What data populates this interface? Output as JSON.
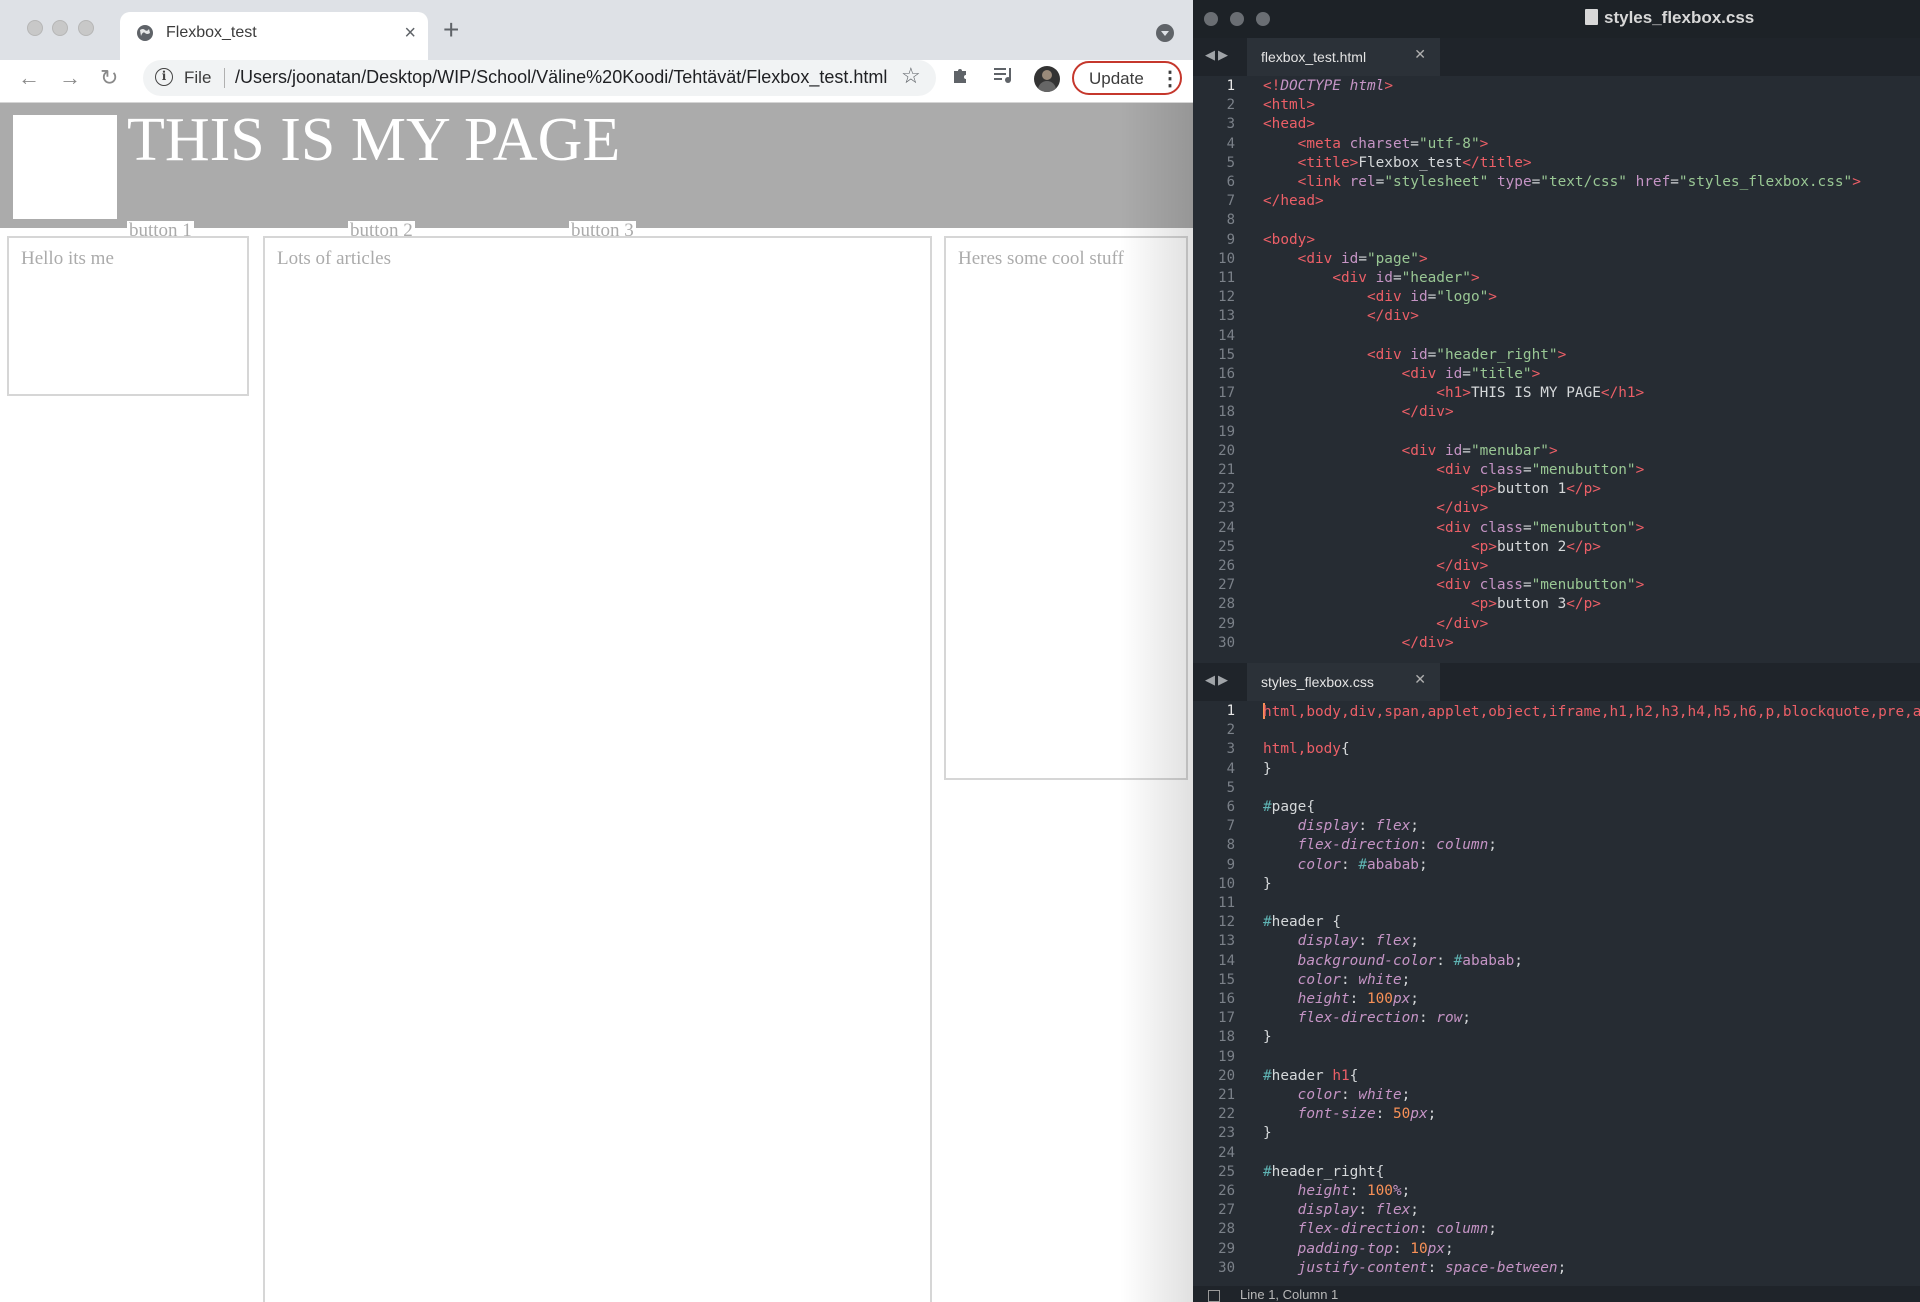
{
  "browser": {
    "tab_title": "Flexbox_test",
    "tab_close": "×",
    "new_tab": "+",
    "nav": {
      "back": "←",
      "forward": "→",
      "reload": "↻"
    },
    "omnibox": {
      "scheme_label": "File",
      "url": "/Users/joonatan/Desktop/WIP/School/Väline%20Koodi/Tehtävät/Flexbox_test.html",
      "star": "☆"
    },
    "update_label": "Update",
    "menu_dots": "⋮",
    "accent": "#c5372c"
  },
  "webpage": {
    "title": "THIS IS MY PAGE",
    "buttons": [
      "button 1",
      "button 2",
      "button 3"
    ],
    "columns": [
      "Hello its me",
      "Lots of articles",
      "Heres some cool stuff"
    ],
    "header_color": "#ababab",
    "text_color": "#ababab"
  },
  "editor": {
    "window_title": "styles_flexbox.css",
    "top_pane": {
      "tab": "flexbox_test.html",
      "active_line": 1,
      "lines": [
        [
          [
            "k",
            "<!"
          ],
          [
            "i",
            "DOCTYPE"
          ],
          [
            "w",
            " "
          ],
          [
            "i",
            "html"
          ],
          [
            "k",
            ">"
          ]
        ],
        [
          [
            "k",
            "<html>"
          ]
        ],
        [
          [
            "k",
            "<head>"
          ]
        ],
        [
          [
            "w",
            "    "
          ],
          [
            "k",
            "<meta "
          ],
          [
            "a",
            "charset"
          ],
          [
            "w",
            "="
          ],
          [
            "s",
            "\"utf-8\""
          ],
          [
            "k",
            ">"
          ]
        ],
        [
          [
            "w",
            "    "
          ],
          [
            "k",
            "<title>"
          ],
          [
            "w",
            "Flexbox_test"
          ],
          [
            "k",
            "</title>"
          ]
        ],
        [
          [
            "w",
            "    "
          ],
          [
            "k",
            "<link "
          ],
          [
            "a",
            "rel"
          ],
          [
            "w",
            "="
          ],
          [
            "s",
            "\"stylesheet\""
          ],
          [
            "w",
            " "
          ],
          [
            "a",
            "type"
          ],
          [
            "w",
            "="
          ],
          [
            "s",
            "\"text/css\""
          ],
          [
            "w",
            " "
          ],
          [
            "a",
            "href"
          ],
          [
            "w",
            "="
          ],
          [
            "s",
            "\"styles_flexbox.css\""
          ],
          [
            "k",
            ">"
          ]
        ],
        [
          [
            "k",
            "</head>"
          ]
        ],
        [
          [
            "w",
            ""
          ]
        ],
        [
          [
            "k",
            "<body>"
          ]
        ],
        [
          [
            "w",
            "    "
          ],
          [
            "k",
            "<div "
          ],
          [
            "a",
            "id"
          ],
          [
            "w",
            "="
          ],
          [
            "s",
            "\"page\""
          ],
          [
            "k",
            ">"
          ]
        ],
        [
          [
            "w",
            "        "
          ],
          [
            "k",
            "<div "
          ],
          [
            "a",
            "id"
          ],
          [
            "w",
            "="
          ],
          [
            "s",
            "\"header\""
          ],
          [
            "k",
            ">"
          ]
        ],
        [
          [
            "w",
            "            "
          ],
          [
            "k",
            "<div "
          ],
          [
            "a",
            "id"
          ],
          [
            "w",
            "="
          ],
          [
            "s",
            "\"logo\""
          ],
          [
            "k",
            ">"
          ]
        ],
        [
          [
            "w",
            "            "
          ],
          [
            "k",
            "</div>"
          ]
        ],
        [
          [
            "w",
            ""
          ]
        ],
        [
          [
            "w",
            "            "
          ],
          [
            "k",
            "<div "
          ],
          [
            "a",
            "id"
          ],
          [
            "w",
            "="
          ],
          [
            "s",
            "\"header_right\""
          ],
          [
            "k",
            ">"
          ]
        ],
        [
          [
            "w",
            "                "
          ],
          [
            "k",
            "<div "
          ],
          [
            "a",
            "id"
          ],
          [
            "w",
            "="
          ],
          [
            "s",
            "\"title\""
          ],
          [
            "k",
            ">"
          ]
        ],
        [
          [
            "w",
            "                    "
          ],
          [
            "k",
            "<h1>"
          ],
          [
            "w",
            "THIS IS MY PAGE"
          ],
          [
            "k",
            "</h1>"
          ]
        ],
        [
          [
            "w",
            "                "
          ],
          [
            "k",
            "</div>"
          ]
        ],
        [
          [
            "w",
            ""
          ]
        ],
        [
          [
            "w",
            "                "
          ],
          [
            "k",
            "<div "
          ],
          [
            "a",
            "id"
          ],
          [
            "w",
            "="
          ],
          [
            "s",
            "\"menubar\""
          ],
          [
            "k",
            ">"
          ]
        ],
        [
          [
            "w",
            "                    "
          ],
          [
            "k",
            "<div "
          ],
          [
            "a",
            "class"
          ],
          [
            "w",
            "="
          ],
          [
            "s",
            "\"menubutton\""
          ],
          [
            "k",
            ">"
          ]
        ],
        [
          [
            "w",
            "                        "
          ],
          [
            "k",
            "<p>"
          ],
          [
            "w",
            "button 1"
          ],
          [
            "k",
            "</p>"
          ]
        ],
        [
          [
            "w",
            "                    "
          ],
          [
            "k",
            "</div>"
          ]
        ],
        [
          [
            "w",
            "                    "
          ],
          [
            "k",
            "<div "
          ],
          [
            "a",
            "class"
          ],
          [
            "w",
            "="
          ],
          [
            "s",
            "\"menubutton\""
          ],
          [
            "k",
            ">"
          ]
        ],
        [
          [
            "w",
            "                        "
          ],
          [
            "k",
            "<p>"
          ],
          [
            "w",
            "button 2"
          ],
          [
            "k",
            "</p>"
          ]
        ],
        [
          [
            "w",
            "                    "
          ],
          [
            "k",
            "</div>"
          ]
        ],
        [
          [
            "w",
            "                    "
          ],
          [
            "k",
            "<div "
          ],
          [
            "a",
            "class"
          ],
          [
            "w",
            "="
          ],
          [
            "s",
            "\"menubutton\""
          ],
          [
            "k",
            ">"
          ]
        ],
        [
          [
            "w",
            "                        "
          ],
          [
            "k",
            "<p>"
          ],
          [
            "w",
            "button 3"
          ],
          [
            "k",
            "</p>"
          ]
        ],
        [
          [
            "w",
            "                    "
          ],
          [
            "k",
            "</div>"
          ]
        ],
        [
          [
            "w",
            "                "
          ],
          [
            "k",
            "</div>"
          ]
        ]
      ]
    },
    "bottom_pane": {
      "tab": "styles_flexbox.css",
      "active_line": 1,
      "lines": [
        [
          [
            "k",
            "html,body,div,span,applet,object,iframe,h1,h2,h3,h4,h5,h6,p,blockquote,pre,a"
          ]
        ],
        [
          [
            "w",
            ""
          ]
        ],
        [
          [
            "k",
            "html,body"
          ],
          [
            "w",
            "{"
          ]
        ],
        [
          [
            "w",
            "}"
          ]
        ],
        [
          [
            "w",
            ""
          ]
        ],
        [
          [
            "c",
            "#"
          ],
          [
            "w",
            "page{"
          ]
        ],
        [
          [
            "w",
            "    "
          ],
          [
            "i",
            "display"
          ],
          [
            "w",
            ": "
          ],
          [
            "i",
            "flex"
          ],
          [
            "w",
            ";"
          ]
        ],
        [
          [
            "w",
            "    "
          ],
          [
            "i",
            "flex-direction"
          ],
          [
            "w",
            ": "
          ],
          [
            "i",
            "column"
          ],
          [
            "w",
            ";"
          ]
        ],
        [
          [
            "w",
            "    "
          ],
          [
            "i",
            "color"
          ],
          [
            "w",
            ": "
          ],
          [
            "c",
            "#"
          ],
          [
            "a",
            "ababab"
          ],
          [
            "w",
            ";"
          ]
        ],
        [
          [
            "w",
            "}"
          ]
        ],
        [
          [
            "w",
            ""
          ]
        ],
        [
          [
            "c",
            "#"
          ],
          [
            "w",
            "header {"
          ]
        ],
        [
          [
            "w",
            "    "
          ],
          [
            "i",
            "display"
          ],
          [
            "w",
            ": "
          ],
          [
            "i",
            "flex"
          ],
          [
            "w",
            ";"
          ]
        ],
        [
          [
            "w",
            "    "
          ],
          [
            "i",
            "background-color"
          ],
          [
            "w",
            ": "
          ],
          [
            "c",
            "#"
          ],
          [
            "a",
            "ababab"
          ],
          [
            "w",
            ";"
          ]
        ],
        [
          [
            "w",
            "    "
          ],
          [
            "i",
            "color"
          ],
          [
            "w",
            ": "
          ],
          [
            "i",
            "white"
          ],
          [
            "w",
            ";"
          ]
        ],
        [
          [
            "w",
            "    "
          ],
          [
            "i",
            "height"
          ],
          [
            "w",
            ": "
          ],
          [
            "n",
            "100"
          ],
          [
            "i",
            "px"
          ],
          [
            "w",
            ";"
          ]
        ],
        [
          [
            "w",
            "    "
          ],
          [
            "i",
            "flex-direction"
          ],
          [
            "w",
            ": "
          ],
          [
            "i",
            "row"
          ],
          [
            "w",
            ";"
          ]
        ],
        [
          [
            "w",
            "}"
          ]
        ],
        [
          [
            "w",
            ""
          ]
        ],
        [
          [
            "c",
            "#"
          ],
          [
            "w",
            "header "
          ],
          [
            "k",
            "h1"
          ],
          [
            "w",
            "{"
          ]
        ],
        [
          [
            "w",
            "    "
          ],
          [
            "i",
            "color"
          ],
          [
            "w",
            ": "
          ],
          [
            "i",
            "white"
          ],
          [
            "w",
            ";"
          ]
        ],
        [
          [
            "w",
            "    "
          ],
          [
            "i",
            "font-size"
          ],
          [
            "w",
            ": "
          ],
          [
            "n",
            "50"
          ],
          [
            "i",
            "px"
          ],
          [
            "w",
            ";"
          ]
        ],
        [
          [
            "w",
            "}"
          ]
        ],
        [
          [
            "w",
            ""
          ]
        ],
        [
          [
            "c",
            "#"
          ],
          [
            "w",
            "header_right{"
          ]
        ],
        [
          [
            "w",
            "    "
          ],
          [
            "i",
            "height"
          ],
          [
            "w",
            ": "
          ],
          [
            "n",
            "100"
          ],
          [
            "i",
            "%"
          ],
          [
            "w",
            ";"
          ]
        ],
        [
          [
            "w",
            "    "
          ],
          [
            "i",
            "display"
          ],
          [
            "w",
            ": "
          ],
          [
            "i",
            "flex"
          ],
          [
            "w",
            ";"
          ]
        ],
        [
          [
            "w",
            "    "
          ],
          [
            "i",
            "flex-direction"
          ],
          [
            "w",
            ": "
          ],
          [
            "i",
            "column"
          ],
          [
            "w",
            ";"
          ]
        ],
        [
          [
            "w",
            "    "
          ],
          [
            "i",
            "padding-top"
          ],
          [
            "w",
            ": "
          ],
          [
            "n",
            "10"
          ],
          [
            "i",
            "px"
          ],
          [
            "w",
            ";"
          ]
        ],
        [
          [
            "w",
            "    "
          ],
          [
            "i",
            "justify-content"
          ],
          [
            "w",
            ": "
          ],
          [
            "i",
            "space-between"
          ],
          [
            "w",
            ";"
          ]
        ]
      ]
    },
    "status": "Line 1, Column 1",
    "colors": {
      "background": "#262c33",
      "tag": "#ec5f67",
      "string": "#99c794",
      "attribute": "#c594c5",
      "number": "#f99157",
      "hash": "#5fb3b3"
    }
  }
}
